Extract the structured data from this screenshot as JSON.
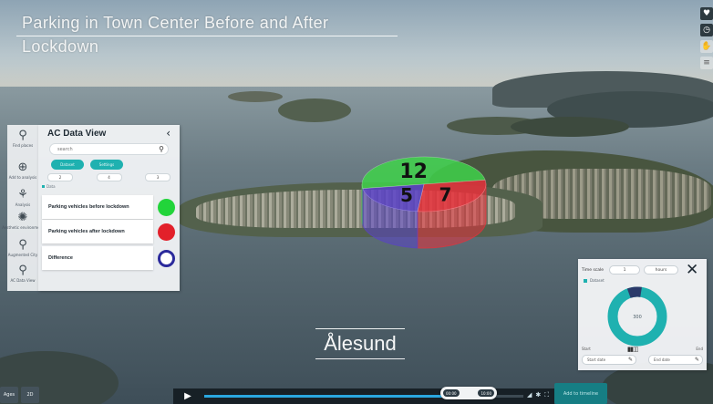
{
  "scene": {
    "title": "Parking in Town Center Before and After Lockdown",
    "city_label": "Ålesund"
  },
  "right_tools": [
    {
      "icon": "heart-icon",
      "glyph": "♥"
    },
    {
      "icon": "clock-icon",
      "glyph": "◷"
    },
    {
      "icon": "hand-icon",
      "glyph": "✋"
    },
    {
      "icon": "layers-icon",
      "glyph": "≡"
    }
  ],
  "tool_sidebar": {
    "items": [
      {
        "icon": "find-places-icon",
        "glyph": "⚲",
        "label": "Find places"
      },
      {
        "icon": "add-to-analysis-icon",
        "glyph": "⊕",
        "label": "Add to analysis"
      },
      {
        "icon": "analysis-icon",
        "glyph": "⚘",
        "label": "Analysis"
      },
      {
        "icon": "aesthetic-environment-icon",
        "glyph": "✺",
        "label": "Aesthetic environment"
      },
      {
        "icon": "augmented-city-icon",
        "glyph": "⚲",
        "label": "Augmented City"
      },
      {
        "icon": "ac-data-view-icon",
        "glyph": "⚲",
        "label": "AC Data View"
      }
    ]
  },
  "ac_panel": {
    "title": "AC Data View",
    "back_glyph": "‹",
    "search_placeholder": "search",
    "search_glyph": "⚲",
    "pills": [
      "Dataset",
      "Settings"
    ],
    "number_boxes": [
      "2",
      "4",
      "3"
    ],
    "legend_label": "Data",
    "items": [
      {
        "label": "Parking vehicles before lockdown",
        "color": "#22d43a",
        "hollow": false
      },
      {
        "label": "Parking vehicles after lockdown",
        "color": "#e2202a",
        "hollow": false
      },
      {
        "label": "Difference",
        "color": "#2b2a9c",
        "hollow": true
      }
    ]
  },
  "pie": {
    "slices": [
      {
        "label": "12",
        "value": 12,
        "color": "#3fd24a"
      },
      {
        "label": "7",
        "value": 7,
        "color": "#e8303b"
      },
      {
        "label": "5",
        "value": 5,
        "color": "#5a42c8"
      }
    ]
  },
  "time_panel": {
    "label": "Time scale",
    "field_a": "1",
    "field_b": "hours",
    "close_glyph": "✕",
    "legend": "Dataset",
    "donut_center": "300",
    "donut_fraction": 0.08,
    "donut_color": "#1fb1b0",
    "donut_accent": "#2b3a6a",
    "bottom_left": "Start",
    "bottom_right": "End",
    "slider_glyph": "▮▮▯▯",
    "input_left": "Start date",
    "input_right": "End date",
    "pen_glyph": "✎"
  },
  "playback": {
    "play_glyph": "▶",
    "progress": 0.76,
    "scrub_left": "00:00",
    "scrub_right": "10:00",
    "icons": [
      "signal-icon",
      "gear-icon",
      "fullscreen-icon"
    ],
    "icon_glyphs": [
      "◢",
      "✱",
      "⛶"
    ],
    "teal_button": "Add to timeline"
  },
  "corner": {
    "buttons": [
      "Ages",
      "2D"
    ]
  }
}
